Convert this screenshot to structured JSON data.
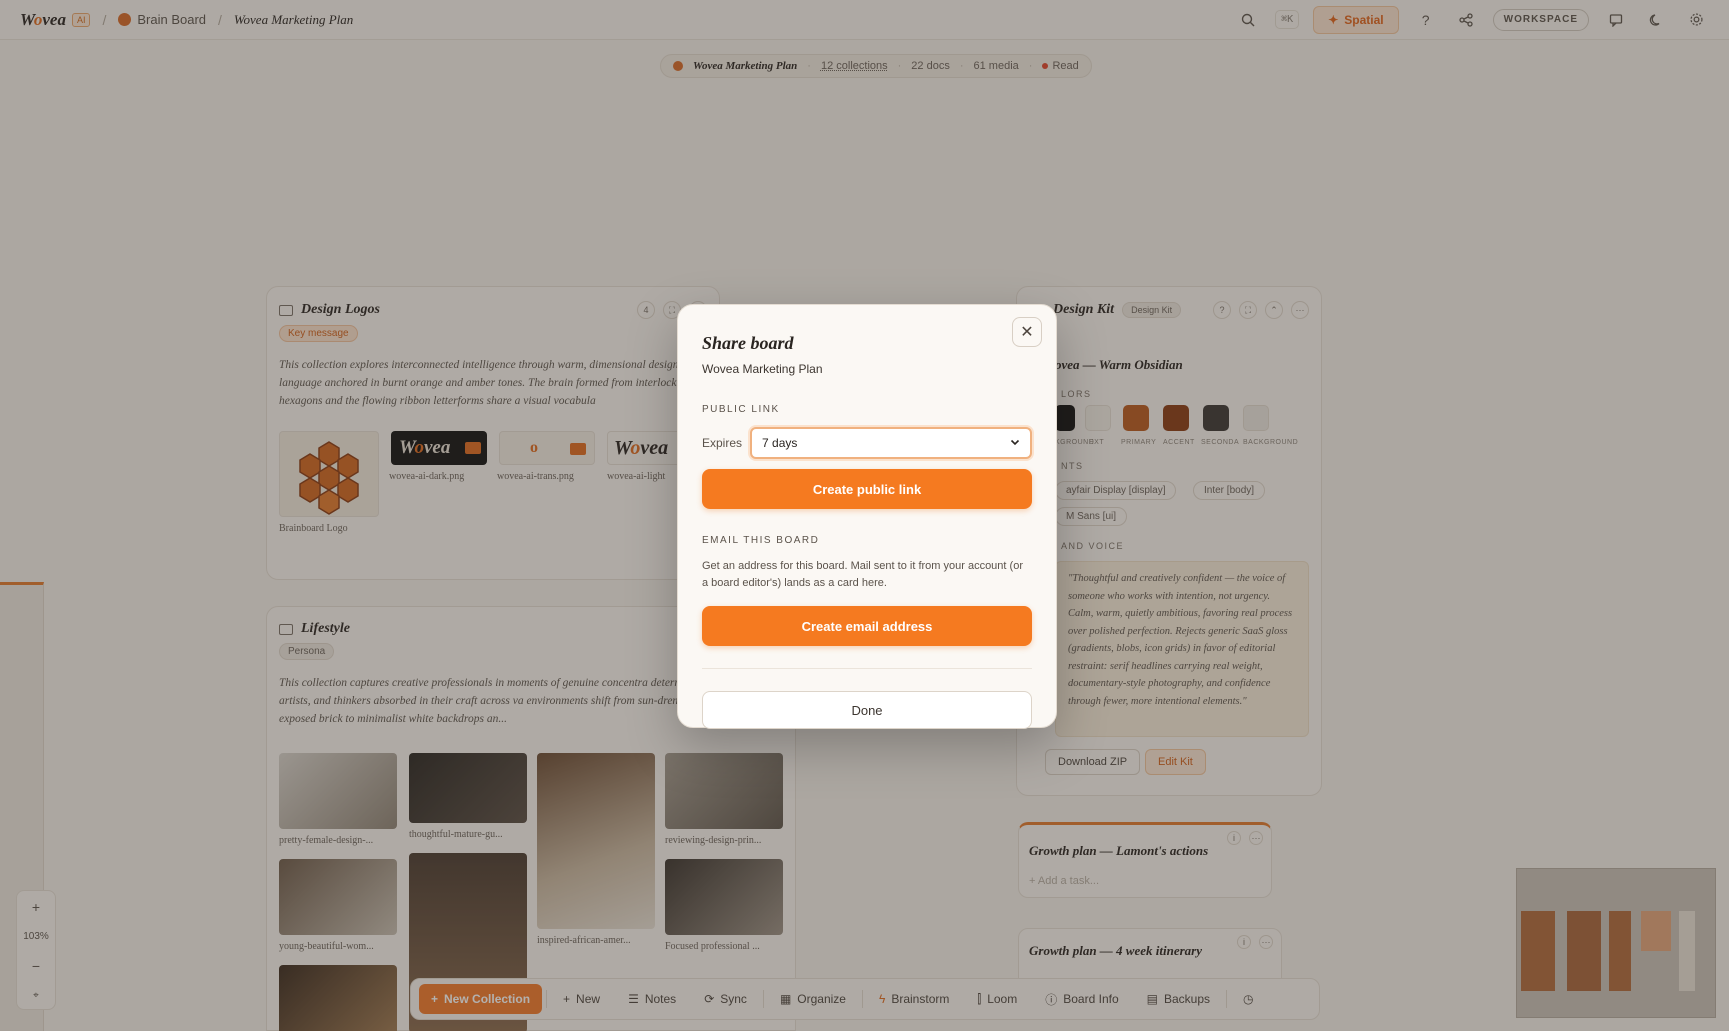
{
  "topbar": {
    "logo": "Wovea",
    "logo_badge": "AI",
    "crumb_board": "Brain Board",
    "crumb_page": "Wovea Marketing Plan",
    "search_shortcut": "⌘K",
    "spatial_label": "Spatial",
    "help_label": "?",
    "workspace_label": "WORKSPACE"
  },
  "infopill": {
    "title": "Wovea Marketing Plan",
    "collections": "12 collections",
    "docs": "22 docs",
    "media": "61 media",
    "mode": "Read"
  },
  "cards": {
    "design_logos": {
      "title": "Design Logos",
      "count": "4",
      "tag": "Key message",
      "body": "This collection explores interconnected intelligence through warm, dimensional design language anchored in burnt orange and amber tones. The brain formed from interlocking hexagons and the flowing ribbon letterforms share a visual vocabula",
      "thumbs": [
        "Brainboard Logo",
        "wovea-ai-dark.png",
        "wovea-ai-trans.png",
        "wovea-ai-light"
      ]
    },
    "lifestyle": {
      "title": "Lifestyle",
      "tag": "Persona",
      "body": "This collection captures creative professionals in moments of genuine concentra determination—designers, artists, and thinkers absorbed in their craft across va environments shift from sun-drenched studios with exposed brick to minimalist white backdrops an...",
      "thumbs": [
        "pretty-female-design-...",
        "thoughtful-mature-gu...",
        "inspired-african-amer...",
        "reviewing-design-prin...",
        "young-beautiful-wom...",
        "Focused professional ..."
      ]
    },
    "design_kit": {
      "title": "Design Kit",
      "badge": "Design Kit",
      "kit_name": "ovea — Warm Obsidian",
      "colors_label": "LORS",
      "swatch_labels": [
        "KGROUND",
        "EXT",
        "PRIMARY",
        "ACCENT",
        "SECONDA",
        "BACKGROUND"
      ],
      "fonts_label": "NTS",
      "fonts": [
        "ayfair Display [display]",
        "Inter [body]",
        "M Sans [ui]"
      ],
      "voice_label": "AND VOICE",
      "voice": "\"Thoughtful and creatively confident — the voice of someone who works with intention, not urgency. Calm, warm, quietly ambitious, favoring real process over polished perfection. Rejects generic SaaS gloss (gradients, blobs, icon grids) in favor of editorial restraint: serif headlines carrying real weight, documentary-style photography, and confidence through fewer, more intentional elements.\"",
      "download_label": "Download ZIP",
      "edit_label": "Edit Kit",
      "colors": [
        "#111111",
        "#f2ede6",
        "#b85a1e",
        "#8a3a12",
        "#3a3633",
        "#ebe6df"
      ]
    },
    "task1": {
      "title": "Growth plan — Lamont's actions",
      "add": "+ Add a task..."
    },
    "task2": {
      "title": "Growth plan — 4 week itinerary"
    }
  },
  "toolbar": {
    "new_collection": "New Collection",
    "new": "New",
    "notes": "Notes",
    "sync": "Sync",
    "organize": "Organize",
    "brainstorm": "Brainstorm",
    "loom": "Loom",
    "board_info": "Board Info",
    "backups": "Backups"
  },
  "zoom": {
    "plus": "+",
    "level": "103%",
    "minus": "−"
  },
  "modal": {
    "title": "Share board",
    "subtitle": "Wovea Marketing Plan",
    "public_link_label": "PUBLIC LINK",
    "expires_label": "Expires",
    "expires_value": "7 days",
    "create_link": "Create public link",
    "email_label": "EMAIL THIS BOARD",
    "email_desc": "Get an address for this board. Mail sent to it from your account (or a board editor's) lands as a card here.",
    "create_email": "Create email address",
    "done": "Done"
  }
}
